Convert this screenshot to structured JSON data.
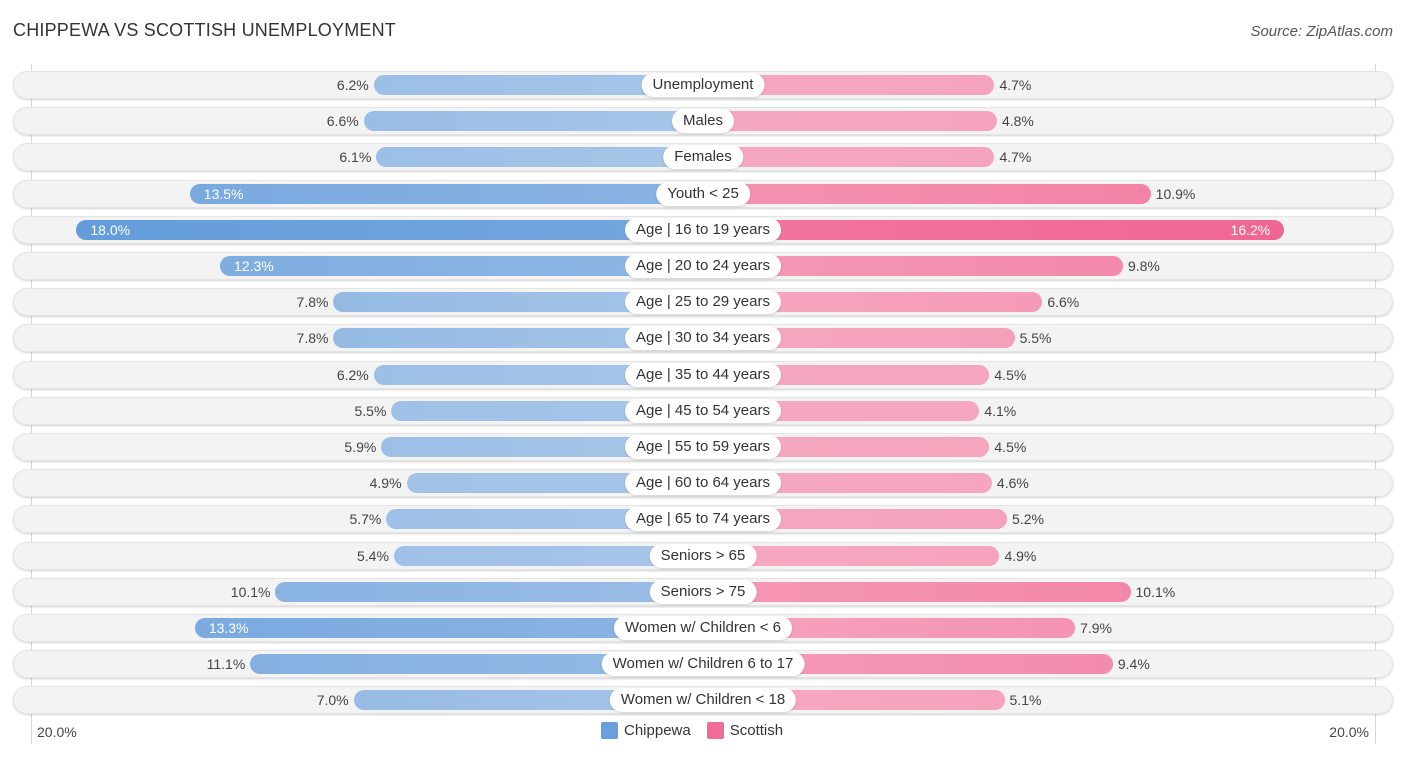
{
  "chart_data": {
    "type": "bar",
    "orientation": "horizontal-diverging",
    "title": "CHIPPEWA VS SCOTTISH UNEMPLOYMENT",
    "source": "Source: ZipAtlas.com",
    "axis": {
      "left_label": "20.0%",
      "right_label": "20.0%",
      "max": 20.0
    },
    "legend": [
      {
        "name": "Chippewa",
        "color": "#6a9fdc"
      },
      {
        "name": "Scottish",
        "color": "#f06b96"
      }
    ],
    "categories": [
      "Unemployment",
      "Males",
      "Females",
      "Youth < 25",
      "Age | 16 to 19 years",
      "Age | 20 to 24 years",
      "Age | 25 to 29 years",
      "Age | 30 to 34 years",
      "Age | 35 to 44 years",
      "Age | 45 to 54 years",
      "Age | 55 to 59 years",
      "Age | 60 to 64 years",
      "Age | 65 to 74 years",
      "Seniors > 65",
      "Seniors > 75",
      "Women w/ Children < 6",
      "Women w/ Children 6 to 17",
      "Women w/ Children < 18"
    ],
    "series": [
      {
        "name": "Chippewa",
        "values": [
          6.2,
          6.6,
          6.1,
          13.5,
          18.0,
          12.3,
          7.8,
          7.8,
          6.2,
          5.5,
          5.9,
          4.9,
          5.7,
          5.4,
          10.1,
          13.3,
          11.1,
          7.0
        ]
      },
      {
        "name": "Scottish",
        "values": [
          4.7,
          4.8,
          4.7,
          10.9,
          16.2,
          9.8,
          6.6,
          5.5,
          4.5,
          4.1,
          4.5,
          4.6,
          5.2,
          4.9,
          10.1,
          7.9,
          9.4,
          5.1
        ]
      }
    ],
    "value_labels": {
      "Chippewa": [
        "6.2%",
        "6.6%",
        "6.1%",
        "13.5%",
        "18.0%",
        "12.3%",
        "7.8%",
        "7.8%",
        "6.2%",
        "5.5%",
        "5.9%",
        "4.9%",
        "5.7%",
        "5.4%",
        "10.1%",
        "13.3%",
        "11.1%",
        "7.0%"
      ],
      "Scottish": [
        "4.7%",
        "4.8%",
        "4.7%",
        "10.9%",
        "16.2%",
        "9.8%",
        "6.6%",
        "5.5%",
        "4.5%",
        "4.1%",
        "4.5%",
        "4.6%",
        "5.2%",
        "4.9%",
        "10.1%",
        "7.9%",
        "9.4%",
        "5.1%"
      ]
    }
  }
}
